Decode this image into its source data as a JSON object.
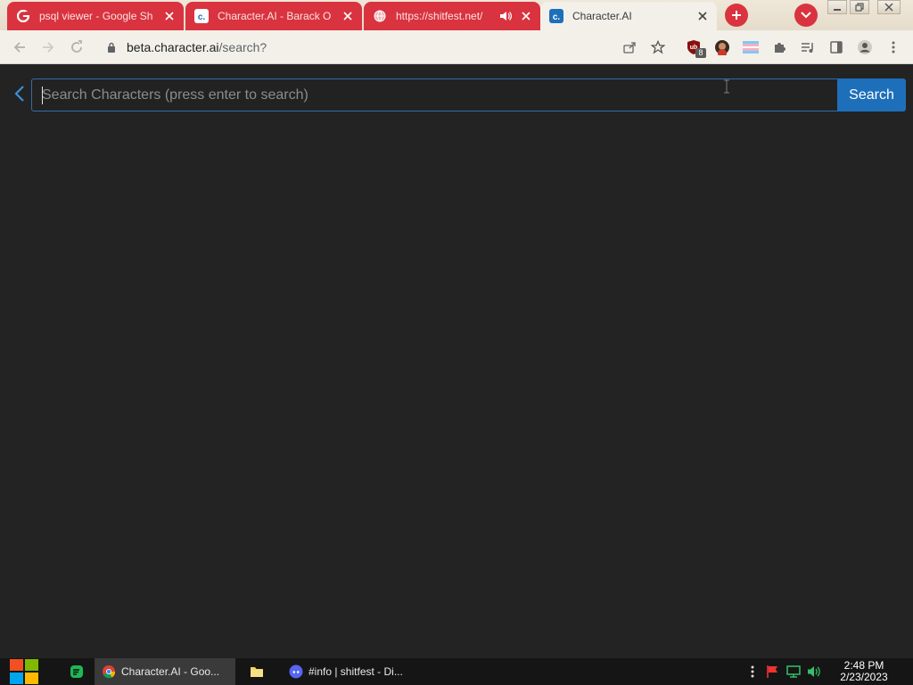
{
  "browser": {
    "tabs": [
      {
        "title": "psql viewer - Google Sh",
        "favicon": "google-icon",
        "color": "#d9333f"
      },
      {
        "title": "Character.AI - Barack O",
        "favicon": "character-ai-icon",
        "color": "#d9333f"
      },
      {
        "title": "https://shitfest.net/",
        "favicon": "globe-icon",
        "audio": "speaker-icon",
        "color": "#d9333f"
      },
      {
        "title": "Character.AI",
        "favicon": "character-ai-icon",
        "active": true
      }
    ],
    "new_tab_icon": "plus-icon",
    "tab_search_icon": "chevron-down-icon",
    "window_controls": [
      "minimize-icon",
      "restore-icon",
      "close-icon"
    ]
  },
  "toolbar": {
    "url_host": "beta.character.ai",
    "url_path": "/search?",
    "extension_badge": "8",
    "icons": [
      "back-icon",
      "forward-icon",
      "reload-icon",
      "share-icon",
      "star-icon",
      "ublock-icon",
      "avatar-ext-icon",
      "flag-ext-icon",
      "puzzle-icon",
      "media-icon",
      "sidepanel-icon",
      "profile-icon",
      "menu-icon"
    ]
  },
  "search": {
    "placeholder": "Search Characters (press enter to search)",
    "button_label": "Search",
    "accent": "#1e6fba"
  },
  "taskbar": {
    "apps": [
      {
        "label": "Character.AI - Goo...",
        "icon": "chrome-icon",
        "active": true
      },
      {
        "label": "",
        "icon": "folder-icon"
      },
      {
        "label": "#info | shitfest - Di...",
        "icon": "discord-icon"
      }
    ],
    "tray_icons": [
      "overflow-icon",
      "flag-icon",
      "network-icon",
      "volume-icon"
    ],
    "time": "2:48 PM",
    "date": "2/23/2023"
  }
}
